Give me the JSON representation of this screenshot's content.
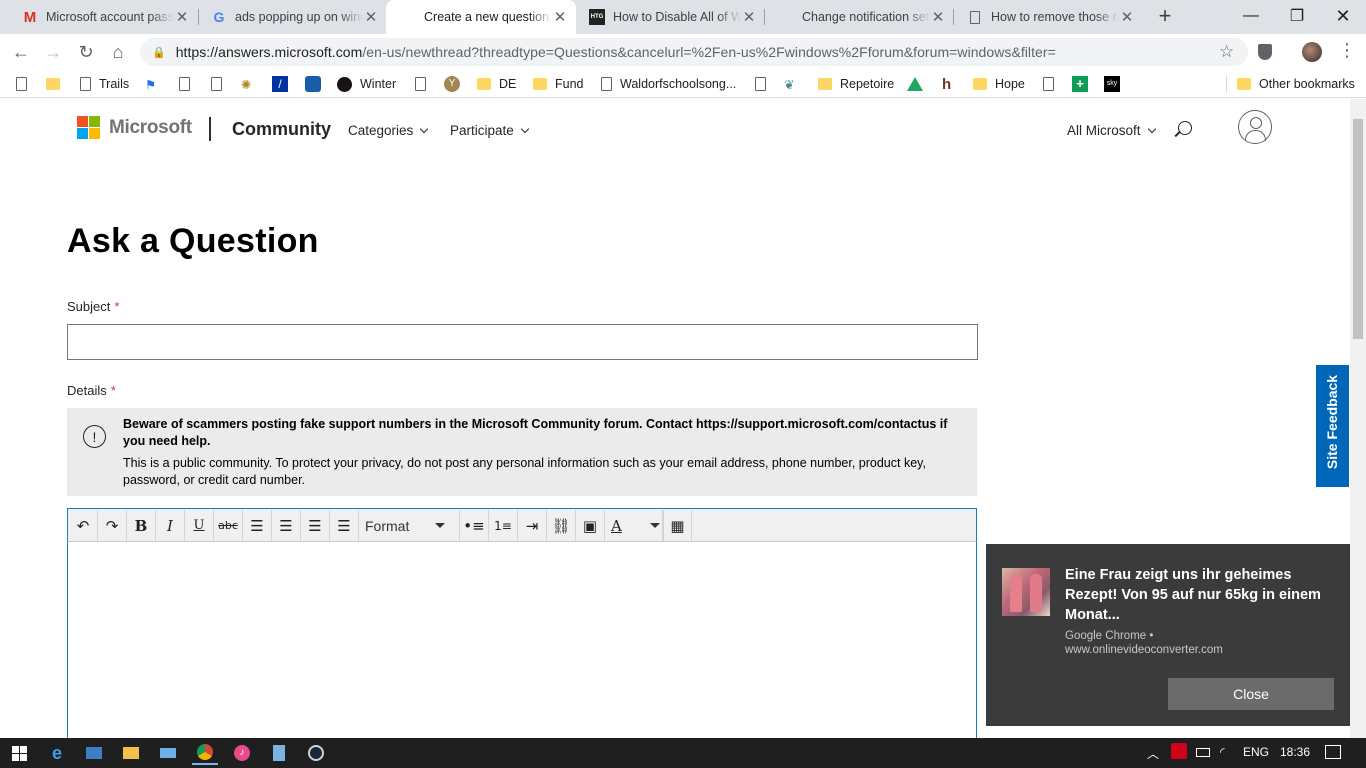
{
  "browser": {
    "tabs": [
      {
        "title": "Microsoft account password",
        "icon": "gmail-icon",
        "active": false
      },
      {
        "title": "ads popping up on windows",
        "icon": "google-icon",
        "active": false
      },
      {
        "title": "Create a new question or",
        "icon": "microsoft-icon",
        "active": true
      },
      {
        "title": "How to Disable All of Windows",
        "icon": "htg-icon",
        "active": false
      },
      {
        "title": "Change notification settings",
        "icon": "microsoft-icon",
        "active": false
      },
      {
        "title": "How to remove those notifications",
        "icon": "page-icon",
        "active": false
      }
    ],
    "url_host": "https://answers.microsoft.com",
    "url_path": "/en-us/newthread?threadtype=Questions&cancelurl=%2Fen-us%2Fwindows%2Fforum&forum=windows&filter=",
    "bookmarks": [
      "Trails",
      "Winter",
      "DE",
      "Fund",
      "Waldorfschoolsong...",
      "Repetoire",
      "Hope"
    ],
    "other_bookmarks": "Other bookmarks"
  },
  "site": {
    "brand": "Microsoft",
    "community": "Community",
    "nav": {
      "categories": "Categories",
      "participate": "Participate",
      "all_microsoft": "All Microsoft"
    }
  },
  "form": {
    "heading": "Ask a Question",
    "subject_label": "Subject",
    "required_mark": "*",
    "subject_value": "",
    "details_label": "Details",
    "notice_bold": "Beware of scammers posting fake support numbers in the Microsoft Community forum. Contact https://support.microsoft.com/contactus if you need help.",
    "notice_text": "This is a public community. To protect your privacy, do not post any personal information such as your email address, phone number, product key, password, or credit card number.",
    "format_label": "Format"
  },
  "feedback": {
    "label": "Site Feedback"
  },
  "toast": {
    "headline": "Eine Frau zeigt uns ihr geheimes Rezept! Von 95 auf nur 65kg in einem Monat...",
    "source_app": "Google Chrome •",
    "source_site": "www.onlinevideoconverter.com",
    "close_label": "Close"
  },
  "taskbar": {
    "language": "ENG",
    "time": "18:36"
  },
  "colors": {
    "accent": "#0067b8",
    "required": "#d13438",
    "toast_bg": "#3b3b3b"
  }
}
